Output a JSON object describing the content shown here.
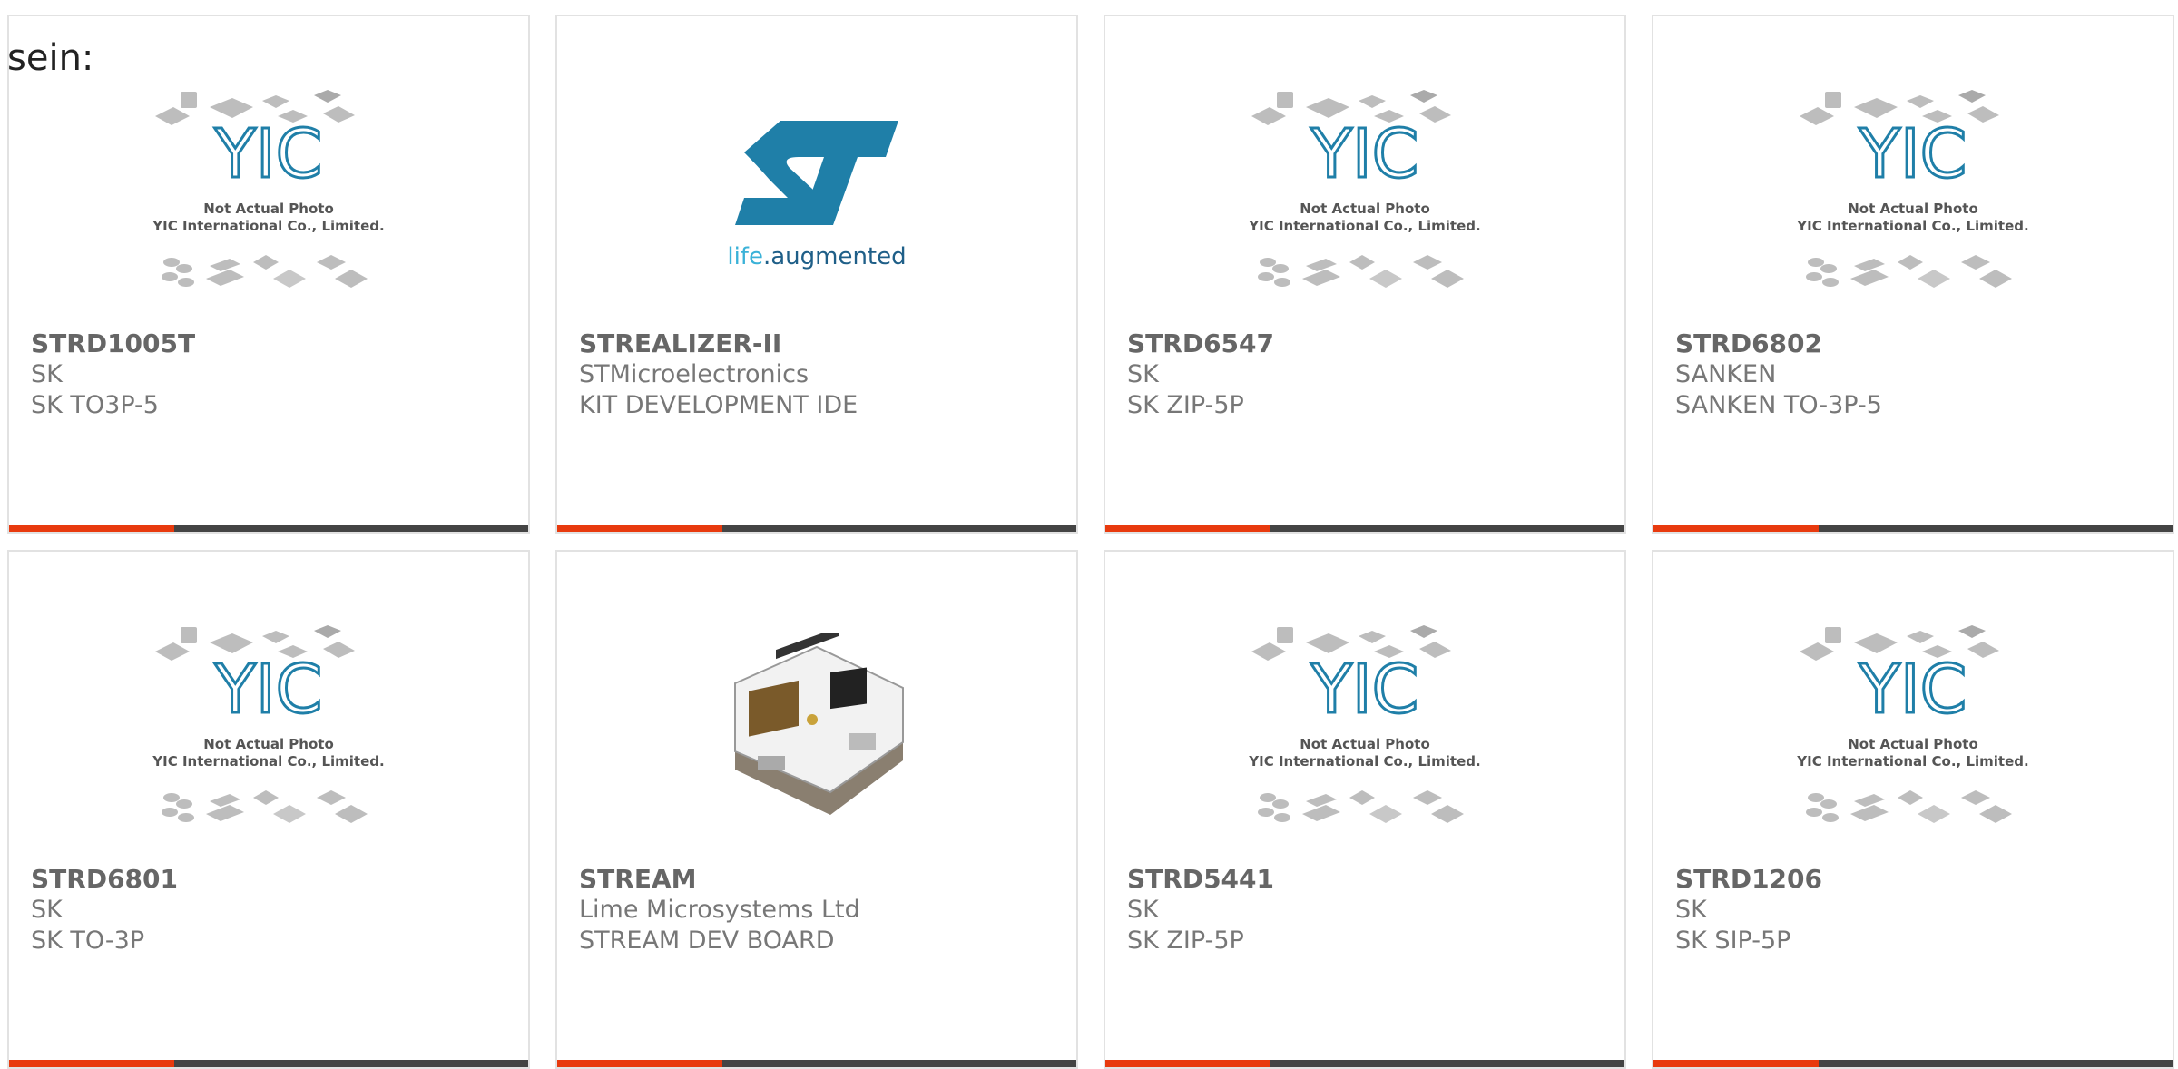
{
  "intro_text": "sein:",
  "placeholder_logo": {
    "letters": "YIC",
    "line1": "Not Actual Photo",
    "line2": "YIC International Co., Limited."
  },
  "st_logo": {
    "wordmark": "life.augmented"
  },
  "colors": {
    "accent": "#e83a0e",
    "bar": "#444444",
    "st_blue": "#1f7fa8",
    "st_cyan": "#3bb2d8"
  },
  "products": [
    {
      "part": "STRD1005T",
      "manufacturer": "SK",
      "description": "SK TO3P-5",
      "image": "yic-placeholder"
    },
    {
      "part": "STREALIZER-II",
      "manufacturer": "STMicroelectronics",
      "description": "KIT DEVELOPMENT IDE",
      "image": "st-logo"
    },
    {
      "part": "STRD6547",
      "manufacturer": "SK",
      "description": "SK ZIP-5P",
      "image": "yic-placeholder"
    },
    {
      "part": "STRD6802",
      "manufacturer": "SANKEN",
      "description": "SANKEN TO-3P-5",
      "image": "yic-placeholder"
    },
    {
      "part": "STRD6801",
      "manufacturer": "SK",
      "description": "SK TO-3P",
      "image": "yic-placeholder"
    },
    {
      "part": "STREAM",
      "manufacturer": "Lime Microsystems Ltd",
      "description": "STREAM DEV BOARD",
      "image": "dev-board-photo"
    },
    {
      "part": "STRD5441",
      "manufacturer": "SK",
      "description": "SK ZIP-5P",
      "image": "yic-placeholder"
    },
    {
      "part": "STRD1206",
      "manufacturer": "SK",
      "description": "SK SIP-5P",
      "image": "yic-placeholder"
    }
  ]
}
